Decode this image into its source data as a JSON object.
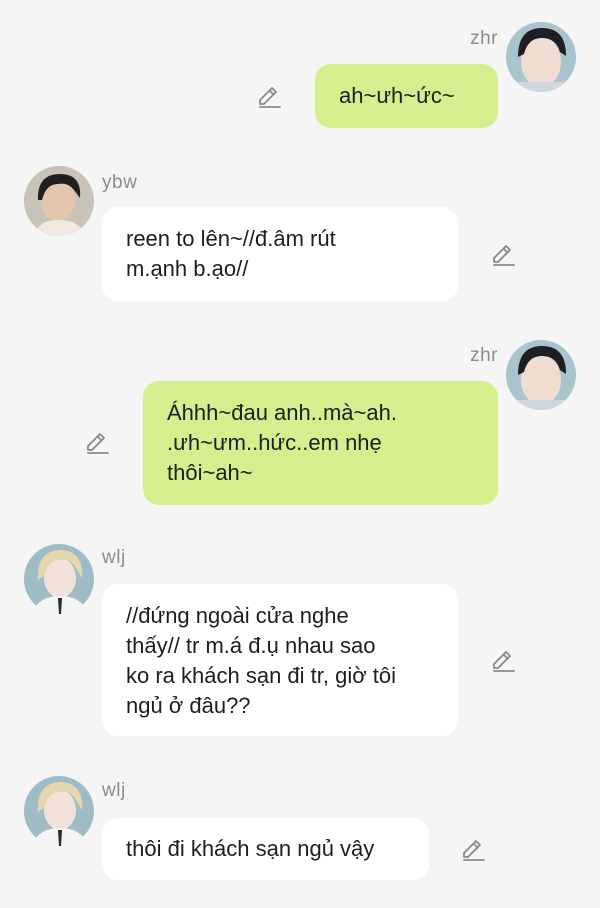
{
  "messages": [
    {
      "sender": "zhr",
      "side": "right",
      "lines": [
        "ah~ưh~ức~"
      ]
    },
    {
      "sender": "ybw",
      "side": "left",
      "lines": [
        "reen to lên~//đ.âm rút",
        "m.ạnh b.ạo//"
      ]
    },
    {
      "sender": "zhr",
      "side": "right",
      "lines": [
        "Áhhh~đau anh..mà~ah.",
        ".ưh~ưm..hức..em nhẹ",
        "thôi~ah~"
      ]
    },
    {
      "sender": "wlj",
      "side": "left",
      "lines": [
        "//đứng ngoài cửa nghe",
        "thấy// tr m.á đ.ụ nhau sao",
        "ko ra khách sạn đi tr, giờ tôi",
        "ngủ ở đâu??"
      ]
    },
    {
      "sender": "wlj",
      "side": "left",
      "lines": [
        "thôi đi khách sạn ngủ vậy"
      ]
    }
  ],
  "colors": {
    "background": "#f5f5f5",
    "sent_bubble": "#d4f08e",
    "received_bubble": "#ffffff",
    "name_text": "#8c8c8c",
    "edit_icon": "#8a8a8a"
  },
  "icons": {
    "edit": "pencil-edit-icon"
  }
}
